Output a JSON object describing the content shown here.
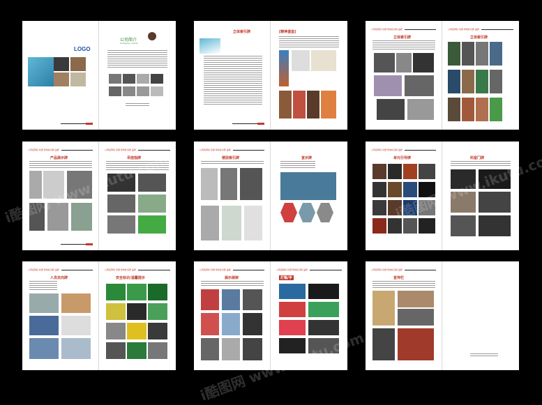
{
  "brochure": {
    "spread1": {
      "logo": "LOGO",
      "intro_title": "公司简介",
      "intro_subtitle": "Company culture"
    },
    "spread2": {
      "left_title": "立体索引牌",
      "right_title": "[精神堡垒]"
    },
    "spread3": {
      "left_title": "立体索引牌",
      "right_title": "立体索引牌"
    },
    "spread4": {
      "left_title": "产品展示牌",
      "right_title": "吊挂指牌"
    },
    "spread5": {
      "left_title": "楼层索引牌",
      "right_title": "宣示牌"
    },
    "spread6": {
      "left_title": "单元引导牌",
      "right_title": "科室门牌"
    },
    "spread7": {
      "left_title": "人员去向牌",
      "right_title": "安全标识/温馨提示"
    },
    "spread8": {
      "left_title": "展示展架",
      "right_title": "灯箱/字"
    },
    "spread9": {
      "left_title": "宣传栏"
    },
    "page_header": "公司名称标 标题 导向标识牌 品牌",
    "watermark": "i酷图网 www.ikutu.com"
  }
}
